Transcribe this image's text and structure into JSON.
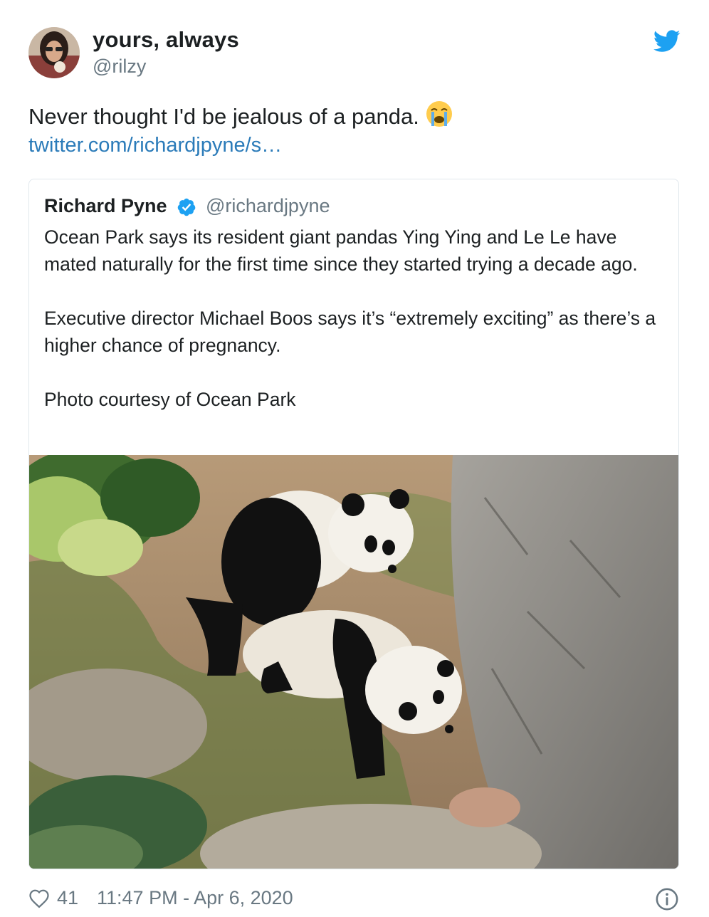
{
  "author": {
    "display_name": "yours, always",
    "handle": "@rilzy",
    "avatar_icon": "avatar-photo"
  },
  "brand": {
    "icon": "twitter-bird-icon",
    "color": "#1da1f2"
  },
  "tweet": {
    "text": "Never thought I'd be jealous of a panda.",
    "emoji_icon": "loudly-crying-face-emoji",
    "link": "twitter.com/richardjpyne/s…"
  },
  "quoted_tweet": {
    "display_name": "Richard Pyne",
    "verified_icon": "verified-badge-icon",
    "handle": "@richardjpyne",
    "paragraphs": [
      "Ocean Park says its resident giant pandas Ying Ying and Le Le have mated naturally for the first time since they started trying a decade ago.",
      "Executive director Michael Boos says it’s “extremely exciting” as there’s a higher chance of pregnancy.",
      "Photo courtesy of Ocean Park"
    ],
    "photo_icon": "panda-photo"
  },
  "footer": {
    "like_icon": "heart-icon",
    "like_count": "41",
    "timestamp": "11:47 PM - Apr 6, 2020",
    "info_icon": "info-icon"
  },
  "colors": {
    "text": "#1c2022",
    "muted": "#697882",
    "link": "#2b7bb9",
    "border": "#e1e8ed",
    "verified": "#1da1f2"
  }
}
